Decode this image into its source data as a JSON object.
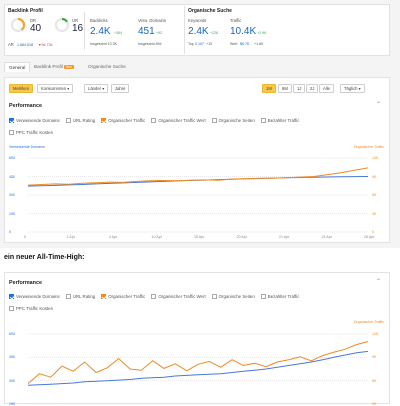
{
  "backlink_profile": {
    "title": "Backlink Profil",
    "dr": {
      "label": "DR",
      "value": "40"
    },
    "ar": {
      "label": "AR",
      "value": "1.684.518",
      "delta": "▼56.736"
    },
    "ur": {
      "label": "UR",
      "value": "16"
    },
    "backlinks": {
      "label": "Backlinks",
      "value": "2.4K",
      "delta": "+364",
      "sub": "Insgesamt 10.3K"
    },
    "ref_domains": {
      "label": "Verw. Domains",
      "value": "451",
      "delta": "+92",
      "sub": "Insgesamt 894"
    }
  },
  "organic_search": {
    "title": "Organische Suche",
    "keywords": {
      "label": "Keywords",
      "value": "2.4K",
      "delta": "+226",
      "sub_prefix": "Top 3",
      "sub_value": "107",
      "sub_delta": "+19"
    },
    "traffic": {
      "label": "Traffic",
      "value": "10.4K",
      "delta": "+2.9K",
      "sub_prefix": "Wert",
      "sub_value": "$6.7K",
      "sub_delta": "+1.6K"
    }
  },
  "tabs": [
    {
      "label": "General",
      "active": true
    },
    {
      "label": "Backlink Profil",
      "badge": "Neu"
    },
    {
      "label": "Organische Suche"
    }
  ],
  "toolbar": {
    "metriken": "Metriken",
    "konkurrenten": "Konkurrenten ▾",
    "laender": "Länder ▾",
    "jahre": "Jahre",
    "ranges": [
      "1M",
      "6M",
      "1J",
      "2J",
      "Alle"
    ],
    "active_range": "1M",
    "interval": "Täglich ▾"
  },
  "performance_1": {
    "title": "Performance",
    "metrics": [
      {
        "label": "Verweisende Domains",
        "checked": true,
        "color": "blue"
      },
      {
        "label": "URL Rating",
        "checked": false
      },
      {
        "label": "Organischer Traffic",
        "checked": true,
        "color": "orange"
      },
      {
        "label": "Organischer Traffic Wert",
        "checked": false
      },
      {
        "label": "Organische Seiten",
        "checked": false
      },
      {
        "label": "Bezahlter Traffic",
        "checked": false
      }
    ],
    "extra_metric": {
      "label": "PPC Traffic Kosten",
      "checked": false
    },
    "left_axis_title": "Verweisende Domains",
    "right_axis_title": "Organischer Traffic",
    "left_ticks": [
      "600",
      "450",
      "300",
      "150",
      "0"
    ],
    "right_ticks": [
      "12K",
      "9K",
      "6K",
      "3K",
      "0"
    ],
    "x_ticks": [
      "0",
      "1 Apr",
      "4 Apr",
      "10 Apr",
      "15 Apr",
      "20 Apr",
      "21 Apr",
      "24 Apr",
      "26 Apr"
    ]
  },
  "caption": "ein neuer All-Time-High:",
  "performance_2": {
    "title": "Performance",
    "metrics": [
      {
        "label": "Verweisende Domains",
        "checked": true,
        "color": "blue"
      },
      {
        "label": "URL Rating",
        "checked": false
      },
      {
        "label": "Organischer Traffic",
        "checked": true,
        "color": "orange"
      },
      {
        "label": "Organischer Traffic Wert",
        "checked": false
      },
      {
        "label": "Organische Seiten",
        "checked": false
      },
      {
        "label": "Bezahlter Traffic",
        "checked": false
      }
    ],
    "extra_metric": {
      "label": "PPC Traffic Kosten",
      "checked": false
    },
    "right_axis_title": "Organischer Traffic",
    "left_ticks": [
      "600",
      "450",
      "300",
      "150"
    ],
    "right_ticks": [
      "12K",
      "9K",
      "6K",
      "3K"
    ]
  },
  "chart_data": [
    {
      "type": "line",
      "series": [
        {
          "name": "Verweisende Domains",
          "color": "#4a78d8",
          "axis": "left",
          "values": [
            372,
            375,
            378,
            382,
            385,
            390,
            394,
            398,
            402,
            406,
            410,
            414,
            418,
            421,
            425,
            428,
            431,
            434,
            437,
            440,
            442,
            444,
            446,
            448,
            449,
            450
          ]
        },
        {
          "name": "Organischer Traffic",
          "color": "#f08a24",
          "axis": "right",
          "values": [
            7600,
            7700,
            7800,
            7750,
            7900,
            8000,
            8100,
            8050,
            8200,
            8300,
            8350,
            8300,
            8400,
            8450,
            8400,
            8600,
            8650,
            8700,
            8700,
            8800,
            8900,
            9000,
            9300,
            9600,
            10000,
            10400
          ]
        }
      ],
      "left_axis": {
        "min": 0,
        "max": 600
      },
      "right_axis": {
        "min": 0,
        "max": 12000
      },
      "grid": true,
      "legend": "checkbox row above chart"
    },
    {
      "type": "line",
      "series": [
        {
          "name": "Verweisende Domains",
          "color": "#4a78d8",
          "axis": "left",
          "values": [
            160,
            165,
            170,
            175,
            180,
            190,
            195,
            200,
            205,
            210,
            220,
            225,
            230,
            240,
            245,
            250,
            255,
            260,
            270,
            280,
            290,
            300,
            315,
            330,
            345,
            360,
            380,
            400,
            420,
            440,
            451
          ]
        },
        {
          "name": "Organischer Traffic",
          "color": "#f08a24",
          "axis": "right",
          "values": [
            3500,
            5200,
            4600,
            6500,
            5600,
            7200,
            5400,
            6200,
            7800,
            6000,
            5800,
            7400,
            6100,
            6900,
            5700,
            6800,
            7300,
            6300,
            7600,
            6600,
            7000,
            6400,
            7200,
            7600,
            8100,
            7400,
            8300,
            8900,
            9400,
            10200,
            10700
          ]
        }
      ],
      "left_axis": {
        "min": 0,
        "max": 600
      },
      "right_axis": {
        "min": 0,
        "max": 12000
      },
      "grid": true,
      "legend": "checkbox row above chart"
    }
  ]
}
